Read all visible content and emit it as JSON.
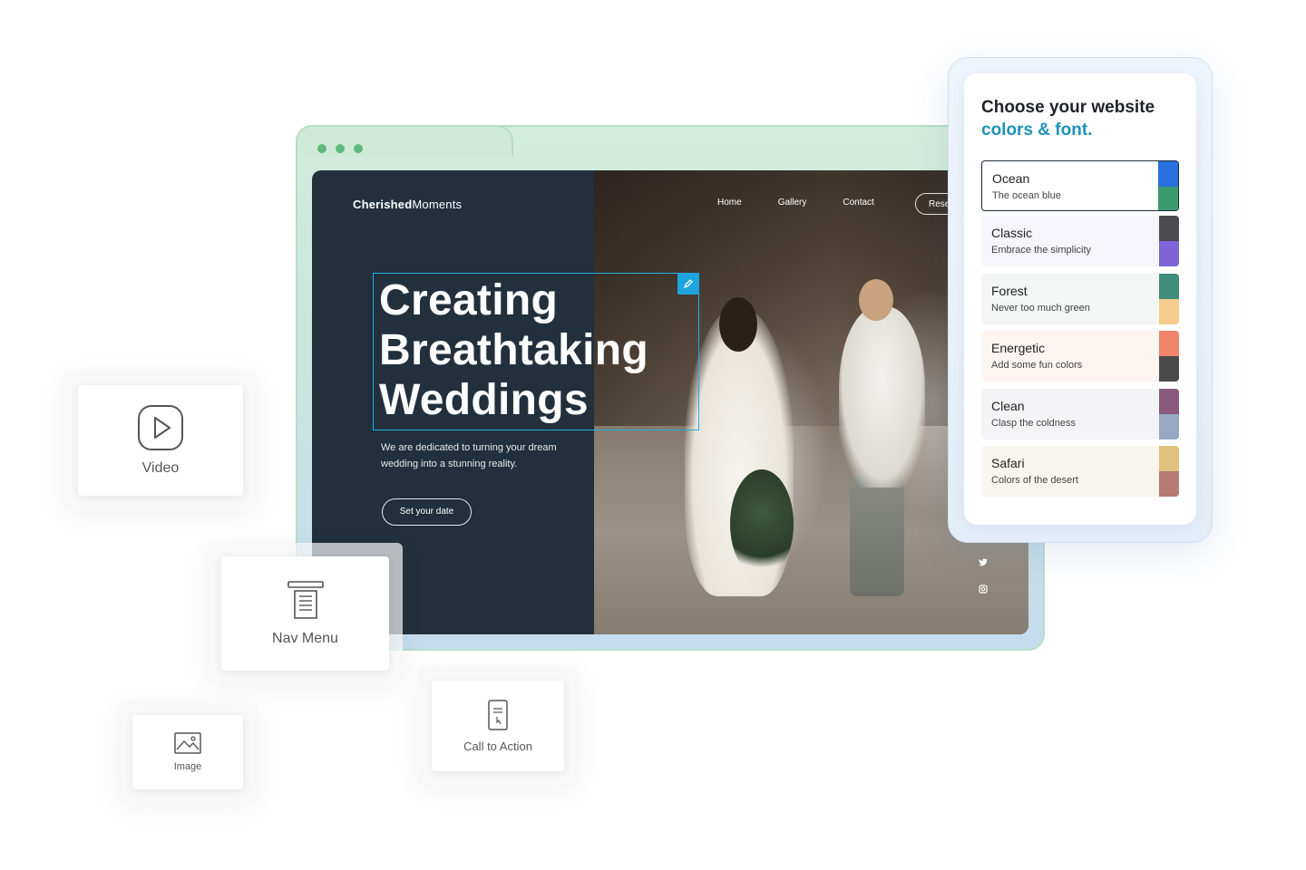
{
  "website": {
    "brand_bold": "Cherished",
    "brand_light": "Moments",
    "nav": [
      "Home",
      "Gallery",
      "Contact"
    ],
    "reserve_label": "Rese",
    "headline": [
      "Creating",
      "Breathtaking",
      "Weddings"
    ],
    "tagline": "We are dedicated to turning your dream wedding into a stunning reality.",
    "cta_label": "Set your date"
  },
  "color_panel": {
    "title_line1": "Choose your website",
    "title_line2": "colors & font.",
    "palettes": [
      {
        "name": "Ocean",
        "desc": "The ocean blue",
        "swatches": [
          "#2a6fe0",
          "#3b9a6e"
        ],
        "bg": "#ffffff",
        "selected": true
      },
      {
        "name": "Classic",
        "desc": "Embrace the simplicity",
        "swatches": [
          "#4b4b4f",
          "#7f64d8"
        ],
        "bg": "#f6f5fb",
        "selected": false
      },
      {
        "name": "Forest",
        "desc": "Never too much green",
        "swatches": [
          "#3f8d7a",
          "#f4cd8d"
        ],
        "bg": "#f3f6f4",
        "selected": false
      },
      {
        "name": "Energetic",
        "desc": "Add some fun colors",
        "swatches": [
          "#f0846b",
          "#4a4a4a"
        ],
        "bg": "#fdf5f2",
        "selected": false
      },
      {
        "name": "Clean",
        "desc": "Clasp the coldness",
        "swatches": [
          "#8a5a7e",
          "#97a8c4"
        ],
        "bg": "#f4f4f7",
        "selected": false
      },
      {
        "name": "Safari",
        "desc": "Colors of the desert",
        "swatches": [
          "#e2c07e",
          "#b57b74"
        ],
        "bg": "#f8f5ef",
        "selected": false
      }
    ]
  },
  "widgets": {
    "video": "Video",
    "nav_menu": "Nav Menu",
    "image": "Image",
    "call_to_action": "Call to Action"
  },
  "colors": {
    "accent_teal": "#1f91b8",
    "selection_blue": "#22b0e3",
    "site_dark": "#22303d",
    "window_dot": "#5fb97f"
  }
}
